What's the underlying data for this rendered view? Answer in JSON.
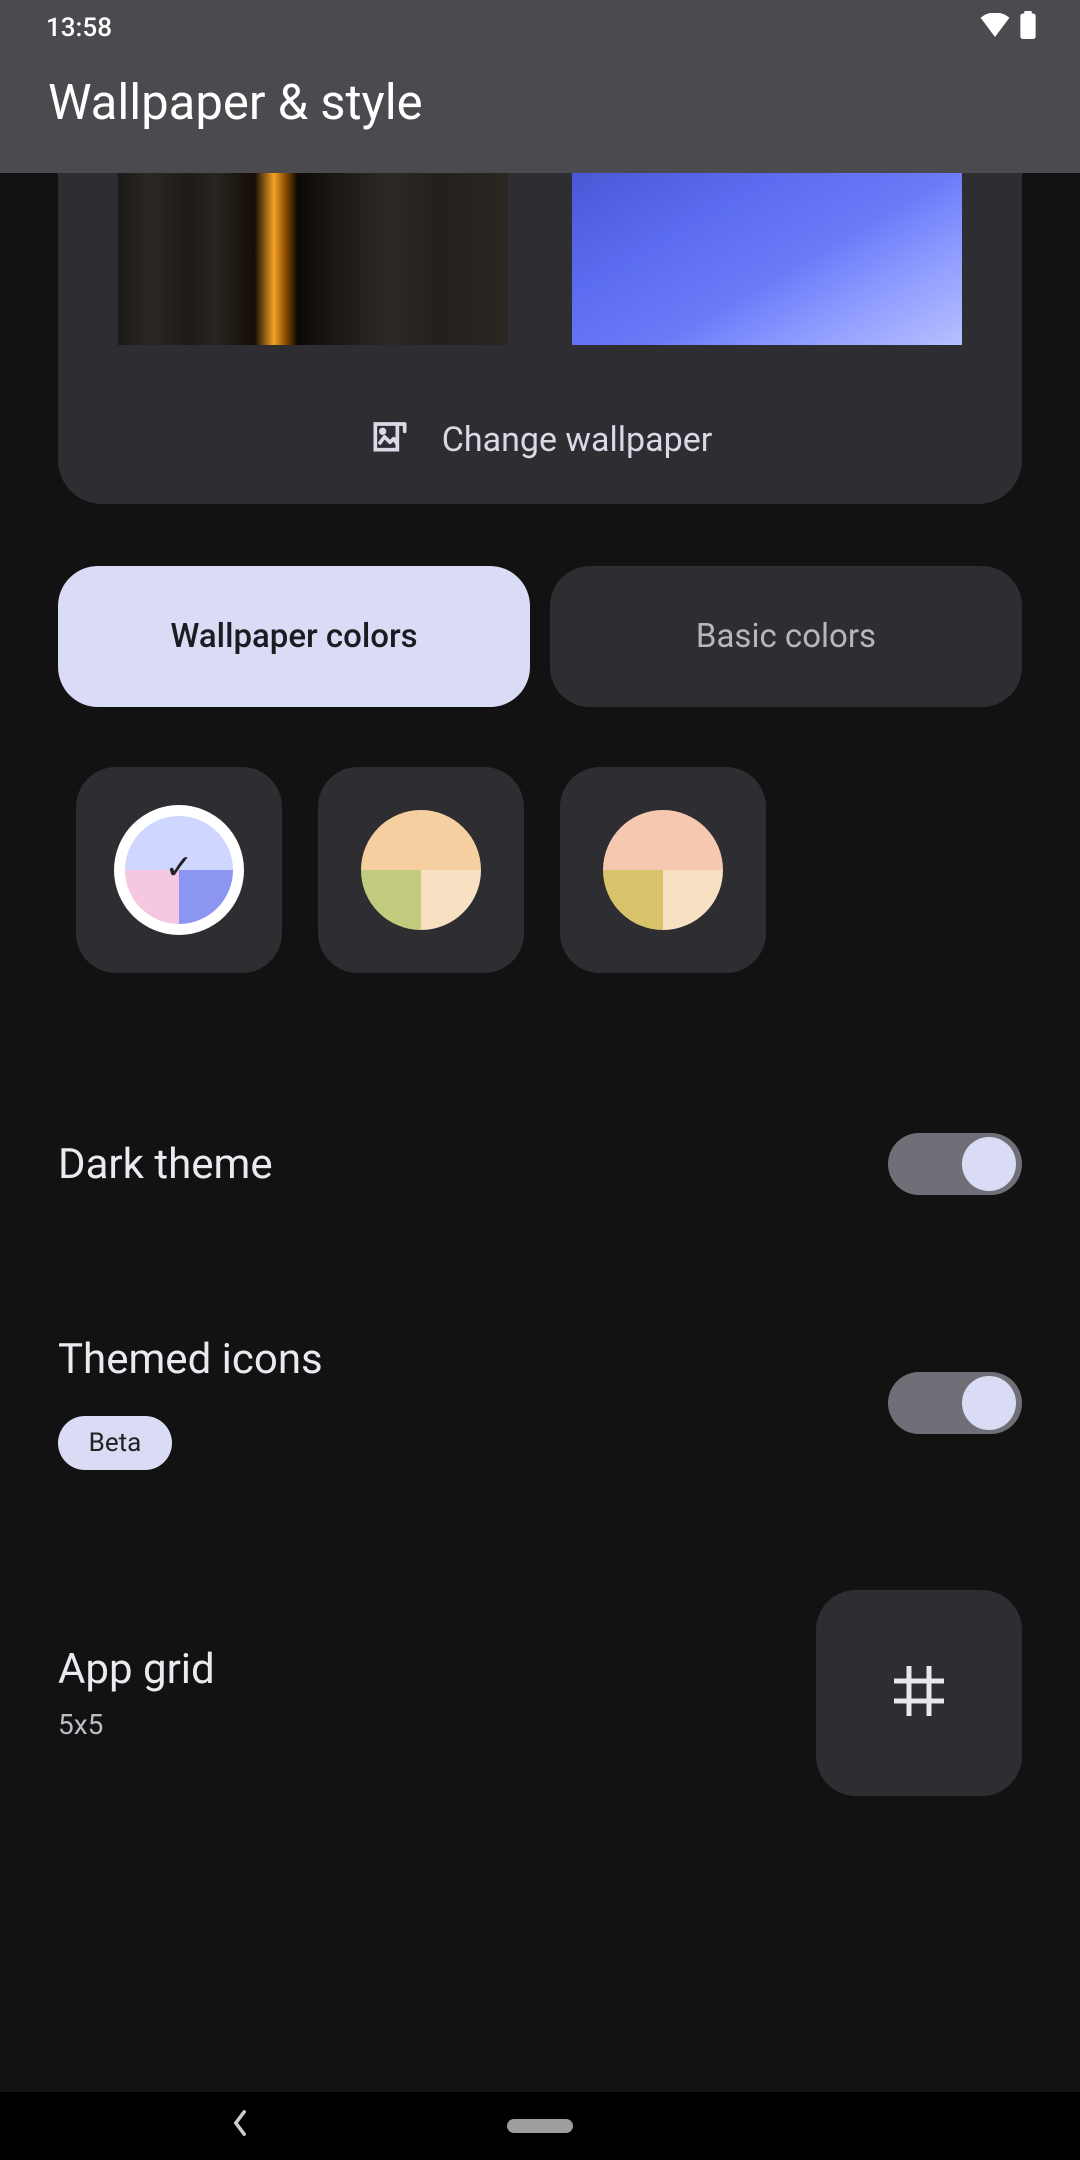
{
  "statusbar": {
    "time": "13:58"
  },
  "header": {
    "title": "Wallpaper & style"
  },
  "change_wallpaper_label": "Change wallpaper",
  "tabs": {
    "wallpaper_colors": "Wallpaper colors",
    "basic_colors": "Basic colors",
    "active": "wallpaper_colors"
  },
  "swatches": [
    {
      "selected": true,
      "colors": {
        "tl": "#cfd6ff",
        "tr": "#cfd6ff",
        "bl": "#f5c7e0",
        "br": "#8b95f2"
      }
    },
    {
      "selected": false,
      "colors": {
        "tl": "#f5cfa0",
        "tr": "#f5cfa0",
        "bl": "#c3cc7e",
        "br": "#f8e0c2"
      }
    },
    {
      "selected": false,
      "colors": {
        "tl": "#f7c8b0",
        "tr": "#f7c8b0",
        "bl": "#d8c36a",
        "br": "#f8e0c2"
      }
    }
  ],
  "settings": {
    "dark_theme": {
      "label": "Dark theme",
      "on": true
    },
    "themed_icons": {
      "label": "Themed icons",
      "badge": "Beta",
      "on": true
    },
    "app_grid": {
      "label": "App grid",
      "value": "5x5"
    }
  }
}
